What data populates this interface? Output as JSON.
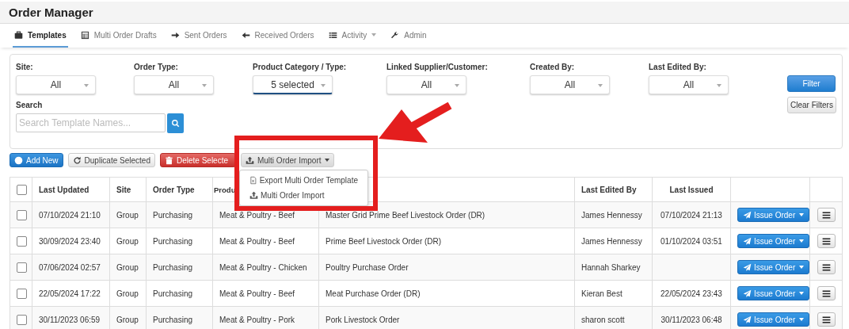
{
  "header": {
    "title": "Order Manager"
  },
  "tabs": [
    {
      "label": "Templates",
      "selected": true,
      "dropdown": false
    },
    {
      "label": "Multi Order Drafts",
      "selected": false,
      "dropdown": false
    },
    {
      "label": "Sent Orders",
      "selected": false,
      "dropdown": false
    },
    {
      "label": "Received Orders",
      "selected": false,
      "dropdown": false
    },
    {
      "label": "Activity",
      "selected": false,
      "dropdown": true
    },
    {
      "label": "Admin",
      "selected": false,
      "dropdown": false
    }
  ],
  "filters": {
    "fields": [
      {
        "label": "Site:",
        "value": "All",
        "focused": false
      },
      {
        "label": "Order Type:",
        "value": "All",
        "focused": false
      },
      {
        "label": "Product Category / Type:",
        "value": "5 selected",
        "focused": true
      },
      {
        "label": "Linked Supplier/Customer:",
        "value": "All",
        "focused": false
      },
      {
        "label": "Created By:",
        "value": "All",
        "focused": false
      },
      {
        "label": "Last Edited By:",
        "value": "All",
        "focused": false
      }
    ],
    "search": {
      "label": "Search",
      "placeholder": "Search Template Names..."
    },
    "filter_button": "Filter",
    "clear_button": "Clear Filters"
  },
  "toolbar": {
    "buttons": [
      {
        "label": "Add New",
        "kind": "add"
      },
      {
        "label": "Duplicate Selected",
        "kind": "duplicate"
      },
      {
        "label": "Delete Selecte",
        "kind": "delete"
      },
      {
        "label": "Multi Order Import",
        "kind": "import"
      }
    ],
    "menu": [
      {
        "label": "Export Multi Order Template",
        "kind": "export"
      },
      {
        "label": "Multi Order Import",
        "kind": "import"
      }
    ]
  },
  "table": {
    "select_all": {
      "checked": false
    },
    "columns": [
      "Last Updated",
      "Site",
      "Order Type",
      "Produ",
      "",
      "Last Edited By",
      "Last Issued"
    ],
    "rows": [
      {
        "checked": false,
        "last_updated": "07/10/2024 21:10",
        "site": "Group",
        "order_type": "Purchasing",
        "product_category": "Meat & Poultry - Beef",
        "name": "Master Grid Prime Beef Livestock Order (DR)",
        "last_edited_by": "James Hennessy",
        "last_issued": "07/10/2024 21:13",
        "action": "Issue Order"
      },
      {
        "checked": false,
        "last_updated": "30/09/2024 23:40",
        "site": "Group",
        "order_type": "Purchasing",
        "product_category": "Meat & Poultry - Beef",
        "name": "Prime Beef Livestock Order (DR)",
        "last_edited_by": "James Hennessy",
        "last_issued": "01/10/2024 03:51",
        "action": "Issue Order"
      },
      {
        "checked": false,
        "last_updated": "07/06/2024 02:57",
        "site": "Group",
        "order_type": "Purchasing",
        "product_category": "Meat & Poultry - Chicken",
        "name": "Poultry Purchase Order",
        "last_edited_by": "Hannah Sharkey",
        "last_issued": "",
        "action": "Issue Order"
      },
      {
        "checked": false,
        "last_updated": "22/05/2024 17:22",
        "site": "Group",
        "order_type": "Purchasing",
        "product_category": "Meat & Poultry - Beef",
        "name": "Meat Purchase Order (DR)",
        "last_edited_by": "Kieran Best",
        "last_issued": "22/05/2024 23:43",
        "action": "Issue Order"
      },
      {
        "checked": false,
        "last_updated": "30/11/2023 06:59",
        "site": "Group",
        "order_type": "Purchasing",
        "product_category": "Meat & Poultry - Pork",
        "name": "Pork Livestock Order",
        "last_edited_by": "sharon scott",
        "last_issued": "30/11/2023 06:48",
        "action": "Issue Order"
      }
    ]
  }
}
